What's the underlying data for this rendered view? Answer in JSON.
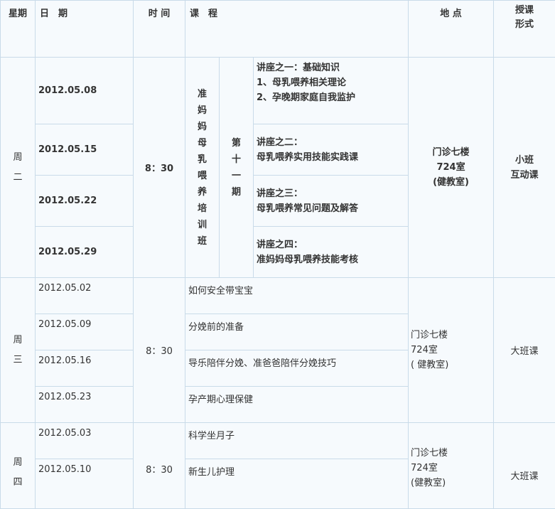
{
  "header": {
    "weekday": "星期",
    "date": "日　期",
    "time": "时 间",
    "course": "课　程",
    "location": "地 点",
    "form_line1": "授课",
    "form_line2": "形式"
  },
  "tuesday": {
    "day_char1": "周",
    "day_char2": "二",
    "dates": [
      "2012.05.08",
      "2012.05.15",
      "2012.05.22",
      "2012.05.29"
    ],
    "time": "8：30",
    "course_name": "准妈妈母乳喂养培训班",
    "period": "第十一期",
    "lectures": [
      {
        "title": "讲座之一：基础知识",
        "line2": "1、母乳喂养相关理论",
        "line3": "2、孕晚期家庭自我监护"
      },
      {
        "title": "讲座之二：",
        "line2": "母乳喂养实用技能实践课"
      },
      {
        "title": "讲座之三：",
        "line2": "母乳喂养常见问题及解答"
      },
      {
        "title": "讲座之四：",
        "line2": "准妈妈母乳喂养技能考核"
      }
    ],
    "location_line1": "门诊七楼",
    "location_line2": "724室",
    "location_line3": "(健教室)",
    "form_line1": "小班",
    "form_line2": "互动课"
  },
  "wednesday": {
    "day_char1": "周",
    "day_char2": "三",
    "dates": [
      "2012.05.02",
      "2012.05.09",
      "2012.05.16",
      "2012.05.23"
    ],
    "time": "8：30",
    "courses": [
      "如何安全带宝宝",
      "分娩前的准备",
      "导乐陪伴分娩、准爸爸陪伴分娩技巧",
      "孕产期心理保健"
    ],
    "location_line1": "门诊七楼",
    "location_line2": "724室",
    "location_line3": "( 健教室)",
    "form": "大班课"
  },
  "thursday": {
    "day_char1": "周",
    "day_char2": "四",
    "dates": [
      "2012.05.03",
      "2012.05.10"
    ],
    "time": "8：30",
    "courses": [
      "科学坐月子",
      "新生儿护理"
    ],
    "location_line1": "门诊七楼",
    "location_line2": "724室",
    "location_line3": "(健教室)",
    "form": "大班课"
  }
}
